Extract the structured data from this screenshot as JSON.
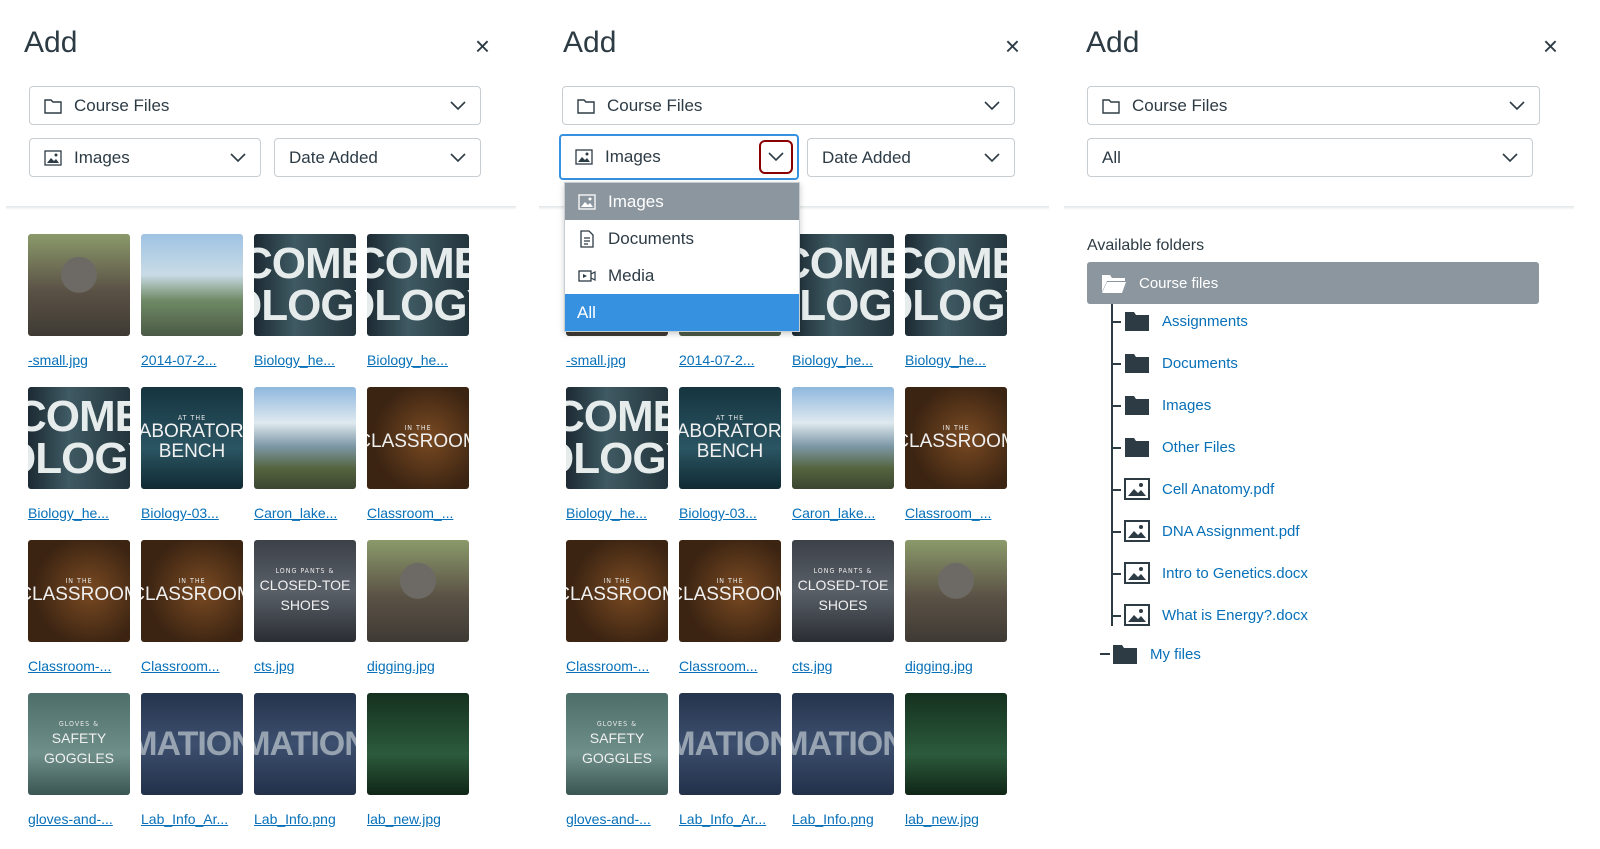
{
  "panels": {
    "title": "Add",
    "close_icon": "×",
    "source_select": "Course Files",
    "type_select": "Images",
    "sort_select": "Date Added",
    "type_select_all": "All"
  },
  "images": [
    {
      "name": "-small.jpg",
      "kind": "mole"
    },
    {
      "name": "2014-07-2...",
      "kind": "lake"
    },
    {
      "name": "Biology_he...",
      "kind": "biology"
    },
    {
      "name": "Biology_he...",
      "kind": "biology"
    },
    {
      "name": "Biology_he...",
      "kind": "biology"
    },
    {
      "name": "Biology-03...",
      "kind": "lab"
    },
    {
      "name": "Caron_lake...",
      "kind": "lake2"
    },
    {
      "name": "Classroom_...",
      "kind": "classroom"
    },
    {
      "name": "Classroom-...",
      "kind": "classroom"
    },
    {
      "name": "Classroom...",
      "kind": "classroom"
    },
    {
      "name": "cts.jpg",
      "kind": "shoes"
    },
    {
      "name": "digging.jpg",
      "kind": "mole"
    },
    {
      "name": "gloves-and-...",
      "kind": "gloves"
    },
    {
      "name": "Lab_Info_Ar...",
      "kind": "mation"
    },
    {
      "name": "Lab_Info.png",
      "kind": "mation"
    },
    {
      "name": "lab_new.jpg",
      "kind": "labgreen"
    }
  ],
  "thumb_text": {
    "biology": [
      "COME",
      "OLOGY"
    ],
    "lab": [
      "AT THE",
      "LABORATORY",
      "BENCH"
    ],
    "classroom": [
      "IN THE",
      "CLASSROOM"
    ],
    "shoes": [
      "LONG PANTS &",
      "CLOSED-TOE SHOES"
    ],
    "gloves": [
      "GLOVES &",
      "SAFETY GOGGLES"
    ],
    "mation": [
      "",
      "MATION"
    ]
  },
  "type_menu": [
    {
      "label": "Images",
      "icon": "image-icon",
      "state": "selected"
    },
    {
      "label": "Documents",
      "icon": "document-icon",
      "state": ""
    },
    {
      "label": "Media",
      "icon": "media-icon",
      "state": ""
    },
    {
      "label": "All",
      "icon": "",
      "state": "active"
    }
  ],
  "folders": {
    "heading": "Available folders",
    "root": "Course files",
    "children": [
      {
        "label": "Assignments",
        "icon": "folder-icon"
      },
      {
        "label": "Documents",
        "icon": "folder-icon"
      },
      {
        "label": "Images",
        "icon": "folder-icon"
      },
      {
        "label": "Other Files",
        "icon": "folder-icon"
      },
      {
        "label": "Cell Anatomy.pdf",
        "icon": "image-file-icon"
      },
      {
        "label": "DNA Assignment.pdf",
        "icon": "image-file-icon"
      },
      {
        "label": "Intro to Genetics.docx",
        "icon": "image-file-icon"
      },
      {
        "label": "What is Energy?.docx",
        "icon": "image-file-icon"
      }
    ],
    "my_files": "My files"
  },
  "colors": {
    "link": "#0770b8",
    "selected_row": "#8b969e",
    "active_row": "#3691e0",
    "focus_ring": "#8b0000"
  }
}
